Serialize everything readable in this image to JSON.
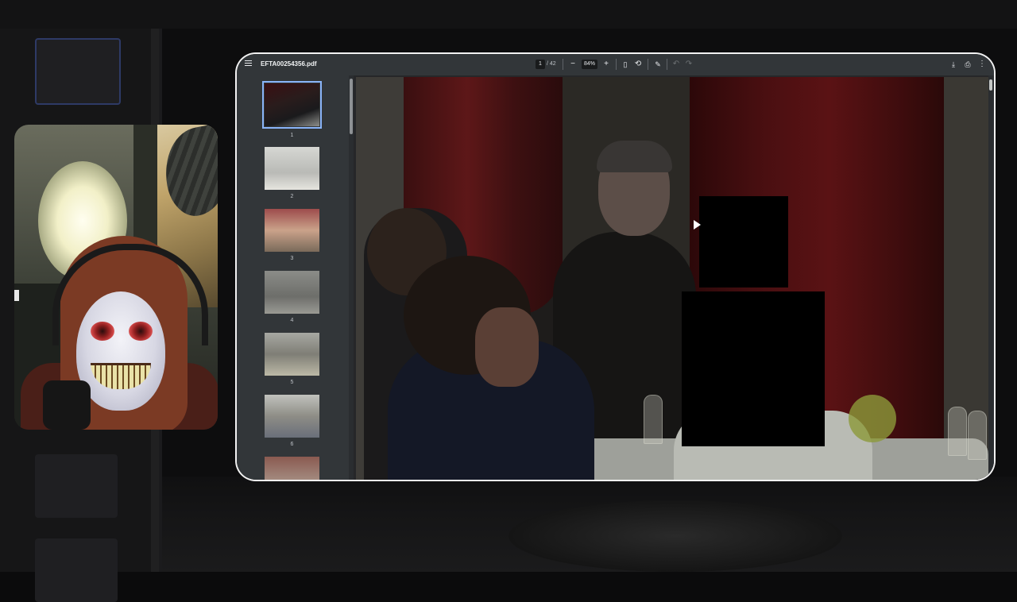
{
  "viewer": {
    "filename": "EFTA00254356.pdf",
    "current_page": "1",
    "page_total": "/ 42",
    "zoom": "84%"
  },
  "icons": {
    "menu": "menu-icon",
    "zoom_out": "minus-icon",
    "zoom_in": "plus-icon",
    "fit_page": "fit-page-icon",
    "rotate": "rotate-icon",
    "annotate": "pen-icon",
    "undo": "undo-icon",
    "redo": "redo-icon",
    "download": "download-icon",
    "print": "print-icon",
    "more": "more-vertical-icon"
  },
  "thumbnails": [
    {
      "label": "1",
      "selected": true
    },
    {
      "label": "2",
      "selected": false
    },
    {
      "label": "3",
      "selected": false
    },
    {
      "label": "4",
      "selected": false
    },
    {
      "label": "5",
      "selected": false
    },
    {
      "label": "6",
      "selected": false
    }
  ],
  "colors": {
    "toolbar_bg": "#323639",
    "selected_outline": "#8ab4f8",
    "redaction": "#000000"
  }
}
